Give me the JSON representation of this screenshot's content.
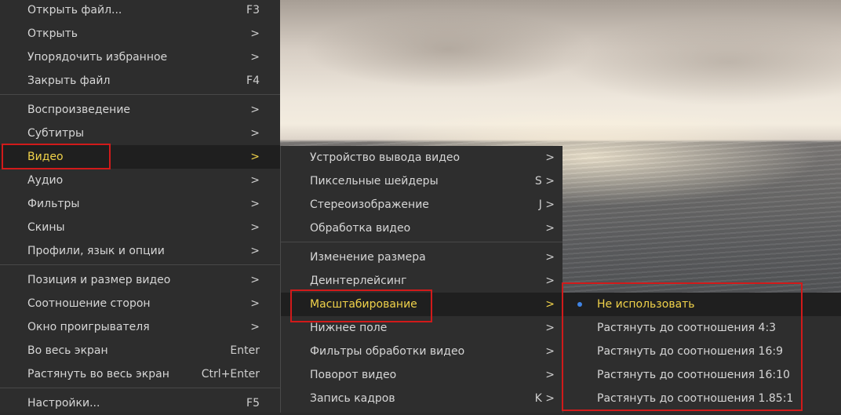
{
  "main_menu": {
    "items": [
      {
        "label": "Открыть файл...",
        "shortcut": "F3"
      },
      {
        "label": "Открыть",
        "shortcut": ">"
      },
      {
        "label": "Упорядочить избранное",
        "shortcut": ">"
      },
      {
        "label": "Закрыть файл",
        "shortcut": "F4"
      },
      {
        "label": "Воспроизведение",
        "shortcut": ">"
      },
      {
        "label": "Субтитры",
        "shortcut": ">"
      },
      {
        "label": "Видео",
        "shortcut": ">"
      },
      {
        "label": "Аудио",
        "shortcut": ">"
      },
      {
        "label": "Фильтры",
        "shortcut": ">"
      },
      {
        "label": "Скины",
        "shortcut": ">"
      },
      {
        "label": "Профили, язык и опции",
        "shortcut": ">"
      },
      {
        "label": "Позиция и размер видео",
        "shortcut": ">"
      },
      {
        "label": "Соотношение сторон",
        "shortcut": ">"
      },
      {
        "label": "Окно проигрывателя",
        "shortcut": ">"
      },
      {
        "label": "Во весь экран",
        "shortcut": "Enter"
      },
      {
        "label": "Растянуть во весь экран",
        "shortcut": "Ctrl+Enter"
      },
      {
        "label": "Настройки...",
        "shortcut": "F5"
      }
    ]
  },
  "video_submenu": {
    "items": [
      {
        "label": "Устройство вывода видео",
        "shortcut": ">"
      },
      {
        "label": "Пиксельные шейдеры",
        "shortcut": "S >"
      },
      {
        "label": "Стереоизображение",
        "shortcut": "J >"
      },
      {
        "label": "Обработка видео",
        "shortcut": ">"
      },
      {
        "label": "Изменение размера",
        "shortcut": ">"
      },
      {
        "label": "Деинтерлейсинг",
        "shortcut": ">"
      },
      {
        "label": "Масштабирование",
        "shortcut": ">"
      },
      {
        "label": "Нижнее поле",
        "shortcut": ">"
      },
      {
        "label": "Фильтры обработки видео",
        "shortcut": ">"
      },
      {
        "label": "Поворот видео",
        "shortcut": ">"
      },
      {
        "label": "Запись кадров",
        "shortcut": "K >"
      }
    ]
  },
  "scaling_submenu": {
    "items": [
      {
        "label": "Не использовать",
        "selected": true
      },
      {
        "label": "Растянуть до соотношения 4:3"
      },
      {
        "label": "Растянуть до соотношения 16:9"
      },
      {
        "label": "Растянуть до соотношения 16:10"
      },
      {
        "label": "Растянуть до соотношения 1.85:1"
      }
    ]
  },
  "colors": {
    "menu_bg": "#2d2d2d",
    "active_text": "#f0d24a",
    "highlight_border": "#d11a1a",
    "radio_dot": "#3f84e5"
  }
}
